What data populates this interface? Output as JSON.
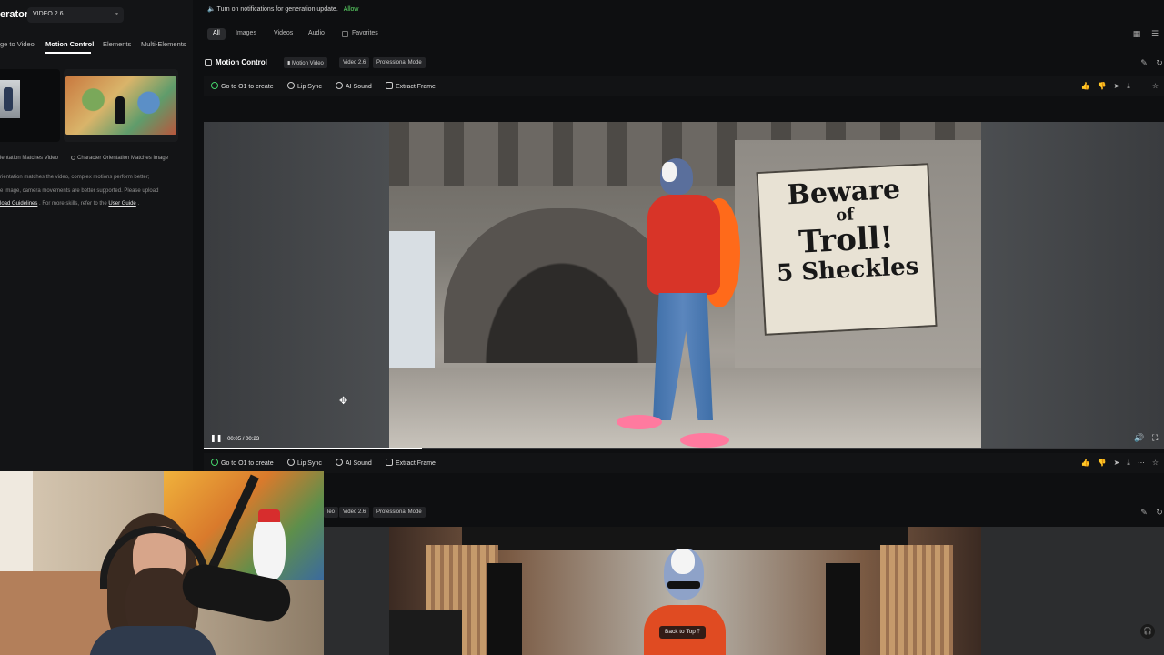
{
  "left": {
    "brand": "erator",
    "model_select": "VIDEO 2.6",
    "tabs": [
      "ge to Video",
      "Motion Control",
      "Elements",
      "Multi-Elements"
    ],
    "active_tab": "Motion Control",
    "captions": {
      "left": "ientation Matches Video",
      "right": "Character Orientation Matches Image"
    },
    "notes": {
      "line1": "rientation matches the video, complex motions perform better;",
      "line2": "e image, camera movements are better supported. Please upload",
      "line3_link1": "load Guidelines",
      "line3_mid": ". For more skills, refer to the",
      "line3_link2": "User Guide",
      "line3_end": "."
    }
  },
  "main": {
    "notification": "Turn on notifications for generation update.",
    "notification_action": "Allow",
    "filters": [
      "All",
      "Images",
      "Videos",
      "Audio"
    ],
    "favorites_label": "Favorites",
    "section1": {
      "title": "Motion Control",
      "tags": [
        "Motion Video",
        "Video 2.6",
        "Professional Mode"
      ]
    },
    "actions": [
      "Go to O1 to create",
      "Lip Sync",
      "AI Sound",
      "Extract Frame"
    ],
    "video1": {
      "time": "00:05 / 00:23",
      "progress_fraction": 0.227,
      "sign_lines": [
        "Beware",
        "of",
        "Troll!",
        "5 Sheckles"
      ]
    },
    "section2": {
      "tags": [
        "leo",
        "Video 2.6",
        "Professional Mode"
      ]
    },
    "back_to_top": "Back to Top"
  }
}
